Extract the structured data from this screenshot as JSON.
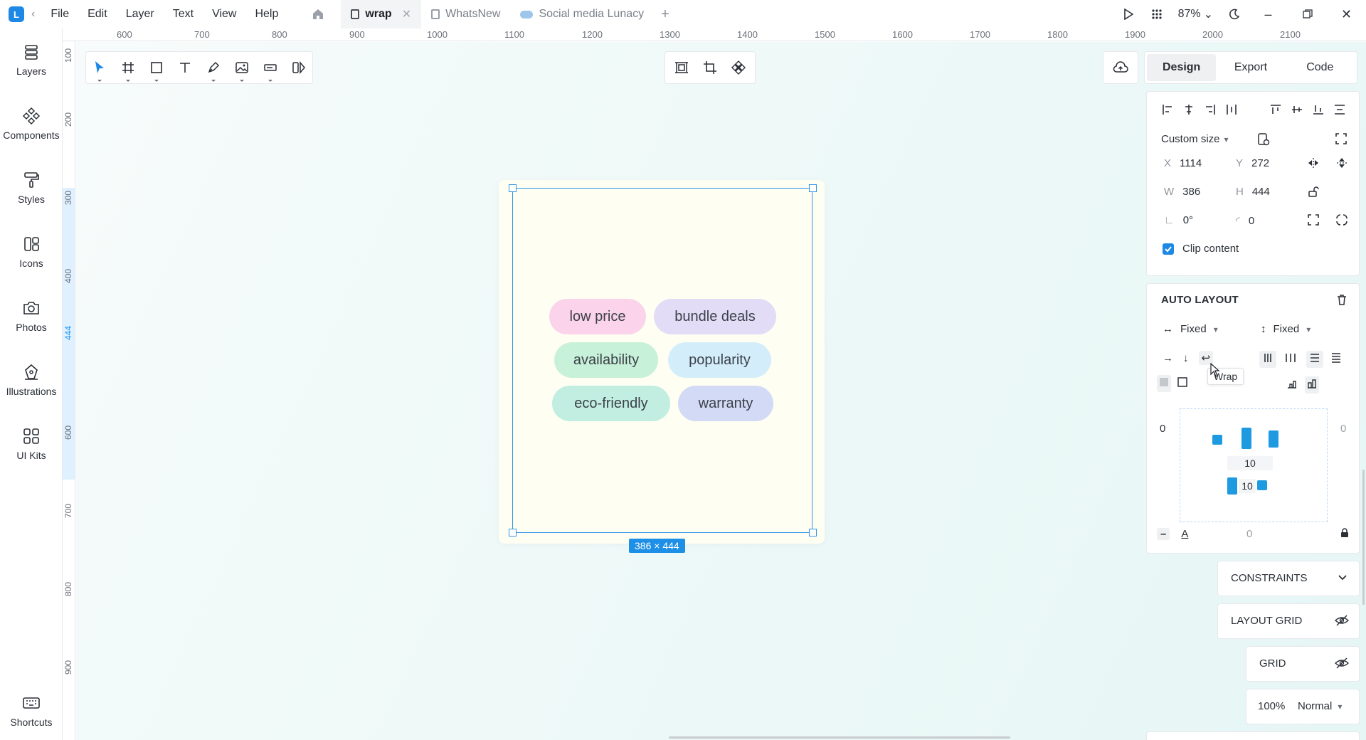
{
  "menu": [
    "File",
    "Edit",
    "Layer",
    "Text",
    "View",
    "Help"
  ],
  "tabs": [
    {
      "label": "wrap",
      "active": true
    },
    {
      "label": "WhatsNew",
      "active": false
    },
    {
      "label": "Social media Lunacy",
      "active": false
    }
  ],
  "zoom": "87%",
  "sidebar": [
    "Layers",
    "Components",
    "Styles",
    "Icons",
    "Photos",
    "Illustrations",
    "UI Kits",
    "Shortcuts"
  ],
  "ruler": {
    "top": [
      "600",
      "700",
      "800",
      "900",
      "1000",
      "1100",
      "1200",
      "1300",
      "1400",
      "1500",
      "1600",
      "1700",
      "1800",
      "1900",
      "2000",
      "2100"
    ],
    "left": [
      "100",
      "200",
      "300",
      "400",
      "444",
      "600",
      "700",
      "800",
      "900"
    ]
  },
  "canvas": {
    "chips": [
      "low price",
      "bundle deals",
      "availability",
      "popularity",
      "eco-friendly",
      "warranty"
    ],
    "size_tag": "386 × 444"
  },
  "right_panel": {
    "tabs": [
      "Design",
      "Export",
      "Code"
    ],
    "size_preset": "Custom size",
    "x_label": "X",
    "x": "1114",
    "y_label": "Y",
    "y": "272",
    "w_label": "W",
    "w": "386",
    "h_label": "H",
    "h": "444",
    "rotation": "0°",
    "radius": "0",
    "clip_content": "Clip content",
    "auto_layout": "AUTO LAYOUT",
    "width_mode": "Fixed",
    "height_mode": "Fixed",
    "tooltip": "Wrap",
    "pad_left": "0",
    "pad_right": "0",
    "gap_h": "10",
    "gap_v": "10",
    "baseline_value": "0",
    "constraints": "CONSTRAINTS",
    "layout_grid": "LAYOUT GRID",
    "grid": "GRID",
    "opacity": "100%",
    "blend": "Normal"
  },
  "colors": {
    "accent": "#1e88e5",
    "chips": [
      "#fbd3ea",
      "#e2dcf7",
      "#c8f1d9",
      "#d3eefa",
      "#c2eee2",
      "#d2daf6"
    ]
  }
}
